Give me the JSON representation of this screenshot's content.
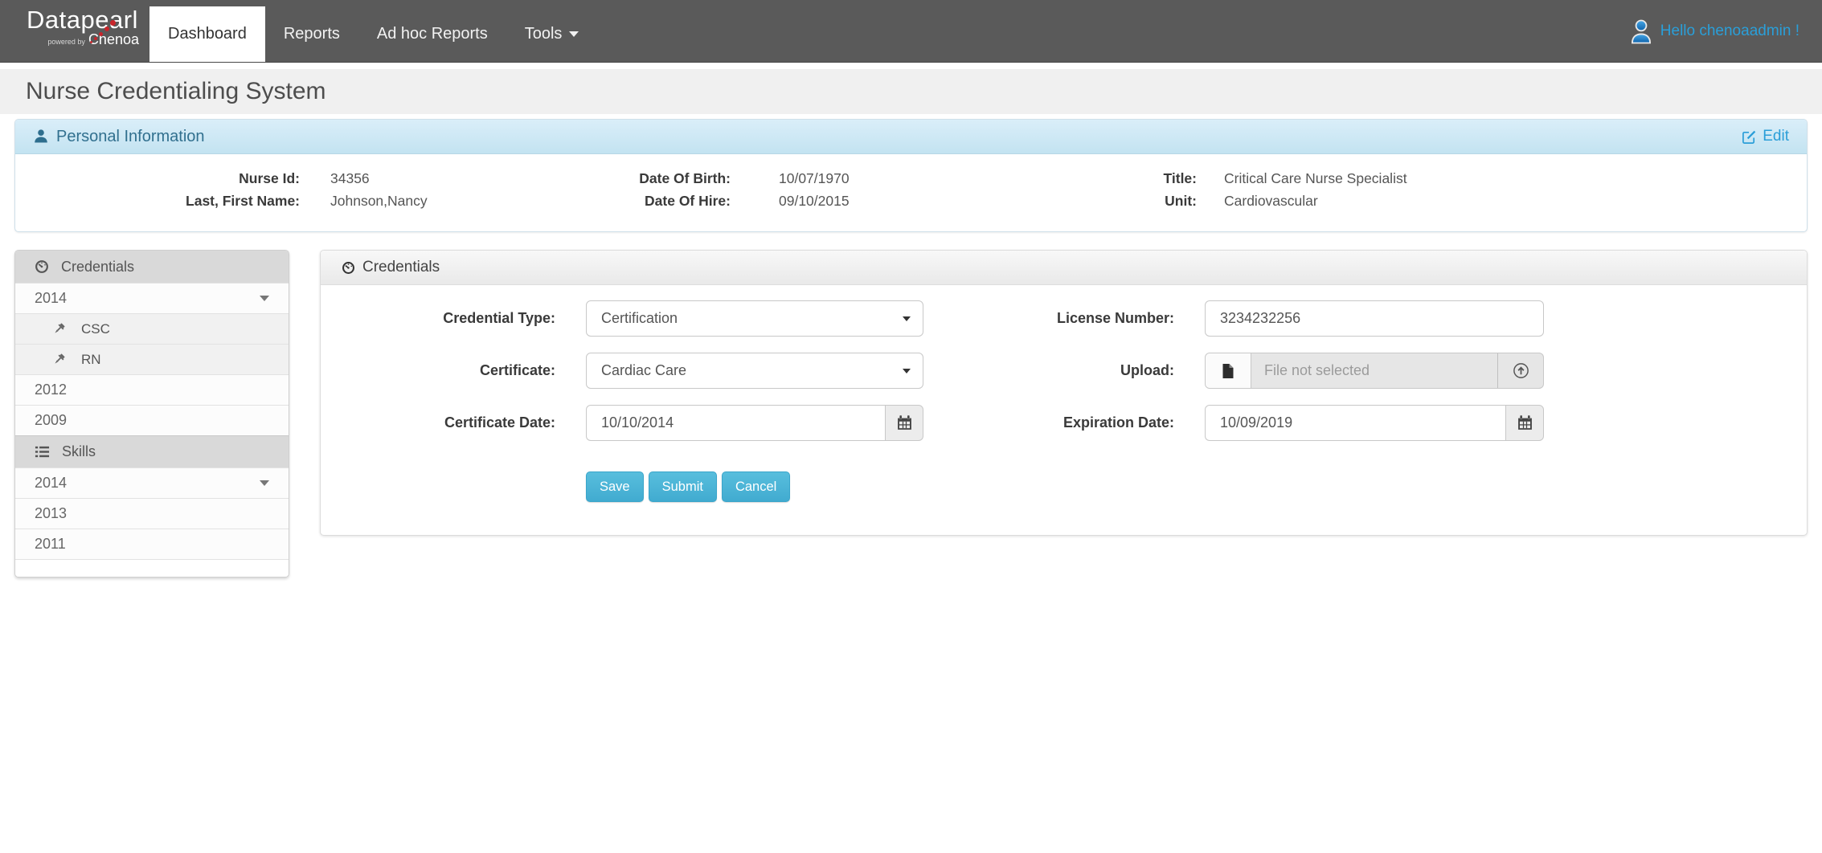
{
  "navbar": {
    "brand": "Datapearl",
    "powered_by_prefix": "powered by",
    "powered_by_brand": "Chenoa",
    "tabs": [
      {
        "label": "Dashboard",
        "active": true
      },
      {
        "label": "Reports",
        "active": false
      },
      {
        "label": "Ad hoc Reports",
        "active": false
      },
      {
        "label": "Tools",
        "active": false,
        "has_dropdown": true
      }
    ],
    "greeting": "Hello chenoaadmin !"
  },
  "page": {
    "title": "Nurse Credentialing System"
  },
  "personal_info": {
    "header": "Personal Information",
    "edit_label": "Edit",
    "fields": [
      {
        "label": "Nurse Id:",
        "value": "34356"
      },
      {
        "label": "Date Of Birth:",
        "value": "10/07/1970"
      },
      {
        "label": "Title:",
        "value": "Critical Care Nurse Specialist"
      },
      {
        "label": "Last, First Name:",
        "value": "Johnson,Nancy"
      },
      {
        "label": "Date Of Hire:",
        "value": "09/10/2015"
      },
      {
        "label": "Unit:",
        "value": "Cardiovascular"
      }
    ]
  },
  "sidebar": {
    "items": [
      {
        "type": "header",
        "label": "Credentials",
        "icon": "gauge-icon"
      },
      {
        "type": "year",
        "label": "2014",
        "expanded": true
      },
      {
        "type": "child",
        "label": "CSC",
        "icon": "pushpin-icon"
      },
      {
        "type": "child",
        "label": "RN",
        "icon": "pushpin-icon"
      },
      {
        "type": "year",
        "label": "2012",
        "expanded": false
      },
      {
        "type": "year",
        "label": "2009",
        "expanded": false
      },
      {
        "type": "header",
        "label": "Skills",
        "icon": "list-icon"
      },
      {
        "type": "year",
        "label": "2014",
        "expanded": true
      },
      {
        "type": "year",
        "label": "2013",
        "expanded": false
      },
      {
        "type": "year",
        "label": "2011",
        "expanded": false
      }
    ]
  },
  "credentials_panel": {
    "header": "Credentials",
    "form": {
      "credential_type": {
        "label": "Credential Type:",
        "value": "Certification"
      },
      "certificate": {
        "label": "Certificate:",
        "value": "Cardiac Care"
      },
      "certificate_date": {
        "label": "Certificate Date:",
        "value": "10/10/2014"
      },
      "license_number": {
        "label": "License Number:",
        "value": "3234232256"
      },
      "upload": {
        "label": "Upload:",
        "placeholder": "File not selected"
      },
      "expiration_date": {
        "label": "Expiration Date:",
        "value": "10/09/2019"
      }
    },
    "buttons": {
      "save": "Save",
      "submit": "Submit",
      "cancel": "Cancel"
    }
  },
  "colors": {
    "navbar_bg": "#5a5a5a",
    "accent_blue": "#2a9fd9",
    "panel_header_bg": "#d9eef9",
    "panel_header_text": "#31708f",
    "button_blue": "#47b2d5",
    "logo_dot_red": "#c9252b"
  }
}
